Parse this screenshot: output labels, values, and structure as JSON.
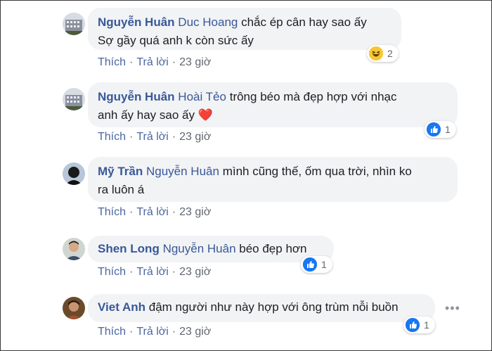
{
  "comments": [
    {
      "author": "Nguyễn Huân",
      "mention": "Duc Hoang",
      "line1": "chắc ép cân hay sao ấy",
      "line2": "Sợ gầy quá anh k còn sức ấy",
      "like": "Thích",
      "reply": "Trả lời",
      "time": "23 giờ",
      "reaction_icon": "haha-icon",
      "reaction_count": "2"
    },
    {
      "author": "Nguyễn Huân",
      "mention": "Hoài Tẻo",
      "line1": "trông béo mà đẹp hợp với nhạc",
      "line2": "anh ấy hay sao ấy ❤️",
      "like": "Thích",
      "reply": "Trả lời",
      "time": "23 giờ",
      "reaction_icon": "like-icon",
      "reaction_count": "1"
    },
    {
      "author": "Mỹ Trần",
      "mention": "Nguyễn Huân",
      "line1": "mình cũng thế, ốm qua trời, nhìn ko",
      "line2": "ra luôn á",
      "like": "Thích",
      "reply": "Trả lời",
      "time": "23 giờ"
    },
    {
      "author": "Shen Long",
      "mention": "Nguyễn Huân",
      "line1": "béo đẹp hơn",
      "like": "Thích",
      "reply": "Trả lời",
      "time": "23 giờ",
      "reaction_icon": "like-icon",
      "reaction_count": "1"
    },
    {
      "author": "Viet Anh",
      "line1": "đậm người như này hợp với ông trùm nỗi buồn",
      "like": "Thích",
      "reply": "Trả lời",
      "time": "23 giờ",
      "reaction_icon": "like-icon",
      "reaction_count": "1"
    }
  ],
  "separator": "·",
  "colors": {
    "link": "#385898",
    "bubble": "#f2f3f5",
    "like_blue": "#1877f2",
    "meta_gray": "#606770"
  }
}
